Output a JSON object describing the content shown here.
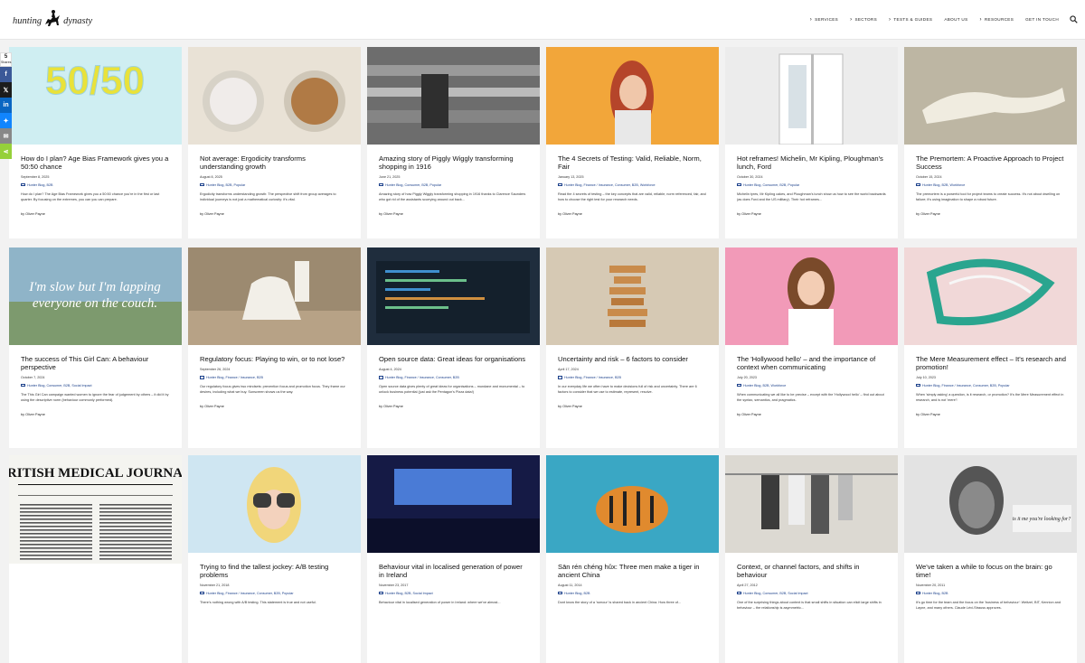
{
  "header": {
    "logo_text_left": "hunting",
    "logo_text_right": "dynasty",
    "nav": [
      {
        "label": "Services",
        "chevron": true
      },
      {
        "label": "Sectors",
        "chevron": true
      },
      {
        "label": "Tests & Guides",
        "chevron": true
      },
      {
        "label": "About us",
        "chevron": false
      },
      {
        "label": "Resources",
        "chevron": true
      },
      {
        "label": "Get in touch",
        "chevron": false
      }
    ],
    "search_icon": "search-icon"
  },
  "share": {
    "count": "5",
    "count_label": "Shares",
    "buttons": [
      {
        "name": "facebook",
        "glyph": "f",
        "color": "#3b5998"
      },
      {
        "name": "x",
        "glyph": "𝕏",
        "color": "#1c1c1c"
      },
      {
        "name": "linkedin",
        "glyph": "in",
        "color": "#0a66c2"
      },
      {
        "name": "bluesky",
        "glyph": "✦",
        "color": "#1185fe"
      },
      {
        "name": "email",
        "glyph": "✉",
        "color": "#888888"
      },
      {
        "name": "sharethis",
        "glyph": "⋖",
        "color": "#95d03a"
      }
    ]
  },
  "posts": [
    {
      "title": "How do I plan? Age Bias Framework gives you a 50:50 chance",
      "date": "September 8, 2025",
      "cats": "Hunter Blog, B2B",
      "excerpt": "How do I plan? The Age Bias Framework gives you a 50:50 chance you're in the first or last quarter. By focusing on the extremes, you can you can prepare.",
      "author": "by Oliver Payne",
      "image_text": "50/50",
      "image_bg": "#cfeef2"
    },
    {
      "title": "Not average: Ergodicity transforms understanding growth",
      "date": "August 8, 2025",
      "cats": "Hunter Blog, B2B, Popular",
      "excerpt": "Ergodicity transforms understanding growth: The perspective shift from group averages to individual journeys is not just a mathematical curiosity: it's vital.",
      "author": "by Oliver Payne",
      "image_text": "",
      "image_bg": "#e9e2d6"
    },
    {
      "title": "Amazing story of Piggly Wiggly transforming shopping in 1916",
      "date": "June 21, 2025",
      "cats": "Hunter Blog, Consumer, B2B, Popular",
      "excerpt": "Amazing story of how Piggly Wiggly transforming shopping in 1916 thanks to Clarence Saunders who got rid of the assistants scurrying around out back...",
      "author": "by Oliver Payne",
      "image_text": "",
      "image_bg": "#777777"
    },
    {
      "title": "The 4 Secrets of Testing: Valid, Reliable, Norm, Fair",
      "date": "January 13, 2025",
      "cats": "Hunter Blog, Finance / Insurance, Consumer, B2B, Workforce",
      "excerpt": "Read the 4 secrets of testing – the key concepts that are valid, reliable, norm referenced, fair, and how to choose the right test for your research needs.",
      "author": "by Oliver Payne",
      "image_text": "",
      "image_bg": "#f2a63a"
    },
    {
      "title": "Hot reframes! Michelin, Mr Kipling, Ploughman's lunch, Ford",
      "date": "October 30, 2024",
      "cats": "Hunter Blog, Consumer, B2B, Popular",
      "excerpt": "Michelin tyres, Mr Kipling cakes, and Ploughman's lunch show us how to see the world backwards (as does Ford and the US military). Their hot reframes...",
      "author": "by Oliver Payne",
      "image_text": "",
      "image_bg": "#e7e7e7"
    },
    {
      "title": "The Premortem: A Proactive Approach to Project Success",
      "date": "October 15, 2024",
      "cats": "Hunter Blog, B2B, Workforce",
      "excerpt": "The premortem is a powerful tool for project teams to create success. It's not about dwelling on failure; it's using imagination to shape a robust future.",
      "author": "by Oliver Payne",
      "image_text": "",
      "image_bg": "#b5ae9c"
    },
    {
      "title": "The success of This Girl Can: A behaviour perspective",
      "date": "October 7, 2024",
      "cats": "Hunter Blog, Consumer, B2B, Social Impact",
      "excerpt": "The This Girl Can campaign wanted women to ignore the fear of judgement by others – it did it by using the descriptive norm (behaviour commonly performed).",
      "author": "by Oliver Payne",
      "image_text": "I'm slow but I'm lapping everyone on the couch.",
      "image_bg": "#8fb4c8"
    },
    {
      "title": "Regulatory focus: Playing to win, or to not lose?",
      "date": "September 26, 2024",
      "cats": "Hunter Blog, Finance / Insurance, B2B",
      "excerpt": "Our regulatory focus gives two mindsets: prevention focus and promotion focus. They frame our desires, including what we buy. Sunscreen shows us the way.",
      "author": "by Oliver Payne",
      "image_text": "",
      "image_bg": "#9c8a70"
    },
    {
      "title": "Open source data: Great ideas for organisations",
      "date": "August 4, 2024",
      "cats": "Hunter Blog, Finance / Insurance, Consumer, B2B",
      "excerpt": "Open source data gives plenty of great ideas for organisations – mundane and monumental – to unlock business potential (just ask the Pentagon's Pizza data!)",
      "author": "by Oliver Payne",
      "image_text": "",
      "image_bg": "#1f2d3d"
    },
    {
      "title": "Uncertainty and risk – 6 factors to consider",
      "date": "April 17, 2024",
      "cats": "Hunter Blog, Finance / Insurance, B2B",
      "excerpt": "In our everyday life we often have to make decisions full of risk and uncertainty. There are 6 factors to consider that we use to estimate, represent, resolve.",
      "author": "by Oliver Payne",
      "image_text": "",
      "image_bg": "#d6c9b4"
    },
    {
      "title": "The 'Hollywood hello' – and the importance of context when communicating",
      "date": "July 20, 2023",
      "cats": "Hunter Blog, B2B, Workforce",
      "excerpt": "When communicating we all like to be precise – except with the 'Hollywood hello' – find out about the syntax, semantics, and pragmatics.",
      "author": "by Oliver Payne",
      "image_text": "",
      "image_bg": "#f29ab8"
    },
    {
      "title": "The Mere Measurement effect – It's research and promotion!",
      "date": "July 10, 2023",
      "cats": "Hunter Blog, Finance / Insurance, Consumer, B2B, Popular",
      "excerpt": "When 'simply asking' a question, is it research, or promotion? It's the Mere Measurement effect in research, and is not 'mere'!",
      "author": "by Oliver Payne",
      "image_text": "",
      "image_bg": "#f1d8d8"
    },
    {
      "title": "",
      "date": "",
      "cats": "",
      "excerpt": "",
      "author": "",
      "image_text": "BRITISH MEDICAL JOURNAL",
      "image_bg": "#f4f4f0"
    },
    {
      "title": "Trying to find the tallest jockey: A/B testing problems",
      "date": "November 21, 2018",
      "cats": "Hunter Blog, Finance / Insurance, Consumer, B2B, Popular",
      "excerpt": "There's nothing wrong with A/B testing. This statement is true and not useful.",
      "author": "",
      "image_text": "",
      "image_bg": "#cfe6f2"
    },
    {
      "title": "Behaviour vital in localised generation of power in Ireland",
      "date": "November 23, 2017",
      "cats": "Hunter Blog, B2B, Social Impact",
      "excerpt": "Behaviour vital in localised generation of power in Ireland: where we've almost...",
      "author": "",
      "image_text": "",
      "image_bg": "#1b2a6b"
    },
    {
      "title": "Sān rén chéng hǔx: Three men make a tiger in ancient China",
      "date": "August 11, 2014",
      "cats": "Hunter Blog, B2B",
      "excerpt": "Dont know the story of a 'rumour' is shared back in ancient China. How three of...",
      "author": "",
      "image_text": "",
      "image_bg": "#3aa7c4"
    },
    {
      "title": "Context, or channel factors, and shifts in behaviour",
      "date": "April 27, 2012",
      "cats": "Hunter Blog, Consumer, B2B, Social Impact",
      "excerpt": "One of the surprising things about context is that small shifts in situation can elicit large shifts in behaviour – the relationship is asymmetric...",
      "author": "",
      "image_text": "",
      "image_bg": "#d8d5ce"
    },
    {
      "title": "We've taken a while to focus on the brain: go time!",
      "date": "November 20, 2011",
      "cats": "Hunter Blog, B2B",
      "excerpt": "It's go time for the team and the focus on the 'business of behaviour': Weitzel, BIT, Kennion and Layne, and many others. Claude Lévi-Strauss approves.",
      "author": "",
      "image_text": "is it me you're looking for?",
      "image_bg": "#e3e3e3"
    }
  ]
}
